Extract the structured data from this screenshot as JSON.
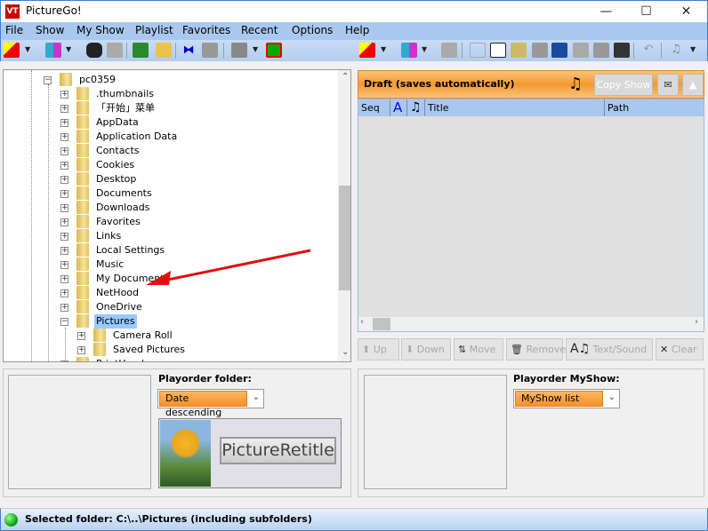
{
  "window": {
    "title": "PictureGo!",
    "app_icon": "VT"
  },
  "menu": [
    "File",
    "Show",
    "My Show",
    "Playlist",
    "Favorites",
    "Recent",
    "Options",
    "Help"
  ],
  "tree": {
    "root": "pc0359",
    "items": [
      ".thumbnails",
      "「开始」菜单",
      "AppData",
      "Application Data",
      "Contacts",
      "Cookies",
      "Desktop",
      "Documents",
      "Downloads",
      "Favorites",
      "Links",
      "Local Settings",
      "Music",
      "My Documents",
      "NetHood",
      "OneDrive",
      "Pictures"
    ],
    "selected": "Pictures",
    "sub_items": [
      "Camera Roll",
      "Saved Pictures"
    ],
    "next_partial": "PrintHood"
  },
  "draft": {
    "title": "Draft (saves automatically)",
    "copy_show": "Copy Show",
    "columns": [
      "Seq",
      "A",
      "♫",
      "Title",
      "Path"
    ]
  },
  "list_buttons": [
    "Up",
    "Down",
    "Move",
    "Remove",
    "Text/Sound",
    "Clear"
  ],
  "left_panel": {
    "label": "Playorder folder:",
    "select_value": "Date descending",
    "preview_button": "PictureRetitle"
  },
  "right_panel": {
    "label": "Playorder MyShow:",
    "select_value": "MyShow list"
  },
  "status": {
    "text": "Selected folder: C:\\..\\Pictures  (including subfolders)",
    "indicator_color": "#22bb22"
  },
  "colors": {
    "accent_orange": "#f39a32",
    "menu_blue": "#a9c8ef",
    "selection": "#99c9ff"
  }
}
